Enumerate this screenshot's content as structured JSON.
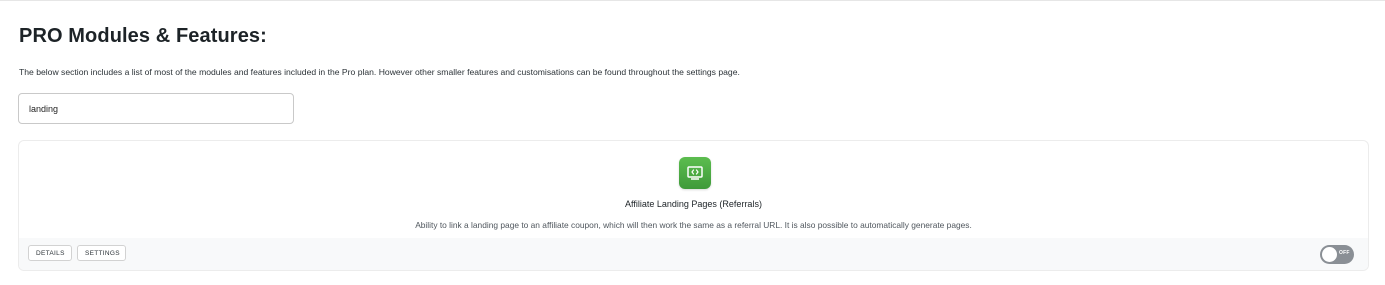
{
  "header": {
    "title": "PRO Modules & Features:",
    "intro": "The below section includes a list of most of the modules and features included in the Pro plan. However other smaller features and customisations can be found throughout the settings page."
  },
  "search": {
    "value": "landing"
  },
  "module": {
    "icon": "code-window-icon",
    "icon_color": "#4caf45",
    "title": "Affiliate Landing Pages (Referrals)",
    "description": "Ability to link a landing page to an affiliate coupon, which will then work the same as a referral URL. It is also possible to automatically generate pages.",
    "details_label": "DETAILS",
    "settings_label": "SETTINGS",
    "toggle_label": "OFF",
    "enabled": false
  }
}
